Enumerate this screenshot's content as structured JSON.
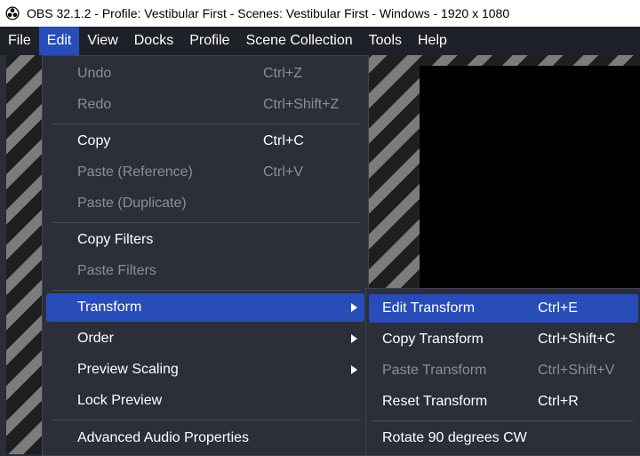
{
  "window": {
    "title": "OBS 32.1.2 - Profile: Vestibular First - Scenes: Vestibular First - Windows - 1920 x 1080"
  },
  "menubar": {
    "items": [
      "File",
      "Edit",
      "View",
      "Docks",
      "Profile",
      "Scene Collection",
      "Tools",
      "Help"
    ],
    "active": "Edit"
  },
  "edit_menu": {
    "undo": {
      "label": "Undo",
      "shortcut": "Ctrl+Z"
    },
    "redo": {
      "label": "Redo",
      "shortcut": "Ctrl+Shift+Z"
    },
    "copy": {
      "label": "Copy",
      "shortcut": "Ctrl+C"
    },
    "paste_reference": {
      "label": "Paste (Reference)",
      "shortcut": "Ctrl+V"
    },
    "paste_duplicate": {
      "label": "Paste (Duplicate)"
    },
    "copy_filters": {
      "label": "Copy Filters"
    },
    "paste_filters": {
      "label": "Paste Filters"
    },
    "transform": {
      "label": "Transform"
    },
    "order": {
      "label": "Order"
    },
    "preview_scaling": {
      "label": "Preview Scaling"
    },
    "lock_preview": {
      "label": "Lock Preview"
    },
    "advanced_audio": {
      "label": "Advanced Audio Properties"
    }
  },
  "transform_menu": {
    "edit_transform": {
      "label": "Edit Transform",
      "shortcut": "Ctrl+E"
    },
    "copy_transform": {
      "label": "Copy Transform",
      "shortcut": "Ctrl+Shift+C"
    },
    "paste_transform": {
      "label": "Paste Transform",
      "shortcut": "Ctrl+Shift+V"
    },
    "reset_transform": {
      "label": "Reset Transform",
      "shortcut": "Ctrl+R"
    },
    "rotate_90_cw": {
      "label": "Rotate 90 degrees CW"
    }
  },
  "colors": {
    "highlight": "#284cb8",
    "menu_bg": "#2c2f3a",
    "disabled_text": "#8b8e98"
  },
  "icons": {
    "app": "obs-logo-icon",
    "submenu": "chevron-right-icon"
  }
}
